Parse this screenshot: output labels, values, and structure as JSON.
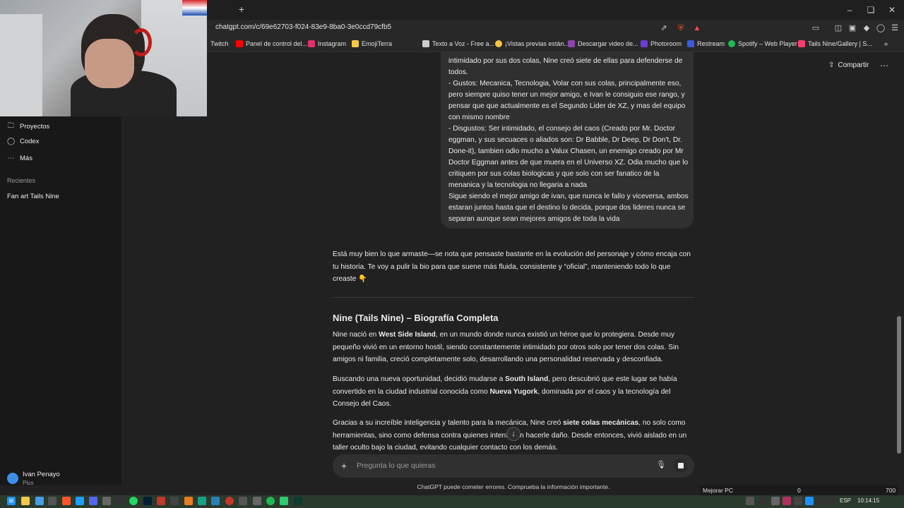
{
  "browser": {
    "url": "chatgpt.com/c/69e62703-f024-83e9-8ba0-3e0ccd79cfb5",
    "new_tab": "+",
    "bookmarks": [
      {
        "label": "Twitch",
        "color": "#9146ff"
      },
      {
        "label": "Panel de control del...",
        "color": "#ff0000"
      },
      {
        "label": "Instagram",
        "color": "#e1306c"
      },
      {
        "label": "EmojiTerra",
        "color": "#f7c948"
      },
      {
        "label": "Texto a Voz - Free a...",
        "color": "#cccccc"
      },
      {
        "label": "¡Vistas previas están...",
        "color": "#f4c542"
      },
      {
        "label": "Descargar video de...",
        "color": "#8e44ad"
      },
      {
        "label": "Photoroom",
        "color": "#6c3bd1"
      },
      {
        "label": "Restream",
        "color": "#3b5bdb"
      },
      {
        "label": "Spotify – Web Player",
        "color": "#1db954"
      },
      {
        "label": "Tails Nine/Gallery | S...",
        "color": "#ff3d6e"
      }
    ]
  },
  "sidebar": {
    "items": [
      {
        "label": "Proyectos",
        "icon": "folder-icon"
      },
      {
        "label": "Codex",
        "icon": "codex-icon"
      },
      {
        "label": "Más",
        "icon": "more-dots-icon"
      }
    ],
    "recent_heading": "Recientes",
    "recent_items": [
      {
        "label": "Fan art Tails Nine"
      }
    ],
    "user": {
      "name": "Ivan Penayo",
      "plan": "Plus"
    }
  },
  "header": {
    "share_label": "Compartir"
  },
  "user_message": {
    "lines": [
      "intimidado por sus dos colas, Nine creó siete de ellas para defenderse de todos.",
      "- Gustos: Mecanica, Tecnologia, Volar con sus colas, principalmente eso, pero siempre quiso tener un mejor amigo, e Ivan le consiguio ese rango, y pensar que que actualmente es el Segundo Lider de XZ, y mas del equipo con mismo nombre",
      "- Disgustos: Ser intimidado, el consejo del caos (Creado por Mr. Doctor eggman, y sus secuaces o aliados son: Dr Babble, Dr Deep, Dr Don't, Dr. Done-it), tambien odio mucho a Valux Chasen, un enemigo creado por Mr Doctor Eggman antes de que muera en el Universo XZ. Odia mucho que lo critiquen por sus colas biologicas y que solo con ser fanatico de la menanica y la tecnologia no llegaria a nada",
      "Sigue siendo el mejor amigo de ivan, que nunca le fallo y viceversa, ambos estaran juntos hasta que el destino lo decida, porque dos lideres nunca se separan aunque sean mejores amigos de toda la vida"
    ]
  },
  "assistant": {
    "intro": "Está muy bien lo que armaste—se nota que pensaste bastante en la evolución del personaje y cómo encaja con tu historia. Te voy a pulir la bio para que suene más fluida, consistente y “oficial”, manteniendo todo lo que creaste 👇",
    "bio_title": "Nine (Tails Nine) – Biografía Completa",
    "p1_a": "Nine nació en ",
    "p1_b": "West Side Island",
    "p1_c": ", en un mundo donde nunca existió un héroe que lo protegiera. Desde muy pequeño vivió en un entorno hostil, siendo constantemente intimidado por otros solo por tener dos colas. Sin amigos ni familia, creció completamente solo, desarrollando una personalidad reservada y desconfiada.",
    "p2_a": "Buscando una nueva oportunidad, decidió mudarse a ",
    "p2_b": "South Island",
    "p2_c": ", pero descubrió que este lugar se había convertido en la ciudad industrial conocida como ",
    "p2_d": "Nueva Yugork",
    "p2_e": ", dominada por el caos y la tecnología del Consejo del Caos.",
    "p3_a": "Gracias a su increíble inteligencia y talento para la mecánica, Nine creó ",
    "p3_b": "siete colas mecánicas",
    "p3_c": ", no solo como herramientas, sino como defensa contra quienes intentaban hacerle daño. Desde entonces, vivió aislado en un taller oculto bajo la ciudad, evitando cualquier contacto con los demás."
  },
  "composer": {
    "placeholder": "Pregunta lo que quieras",
    "disclaimer": "ChatGPT puede cometer errores. Comprueba la información importante."
  },
  "widget": {
    "label": "Mejorar PC",
    "value_a": "0",
    "value_b": "700"
  },
  "taskbar": {
    "language": "ESP",
    "time": "10:14:15"
  }
}
